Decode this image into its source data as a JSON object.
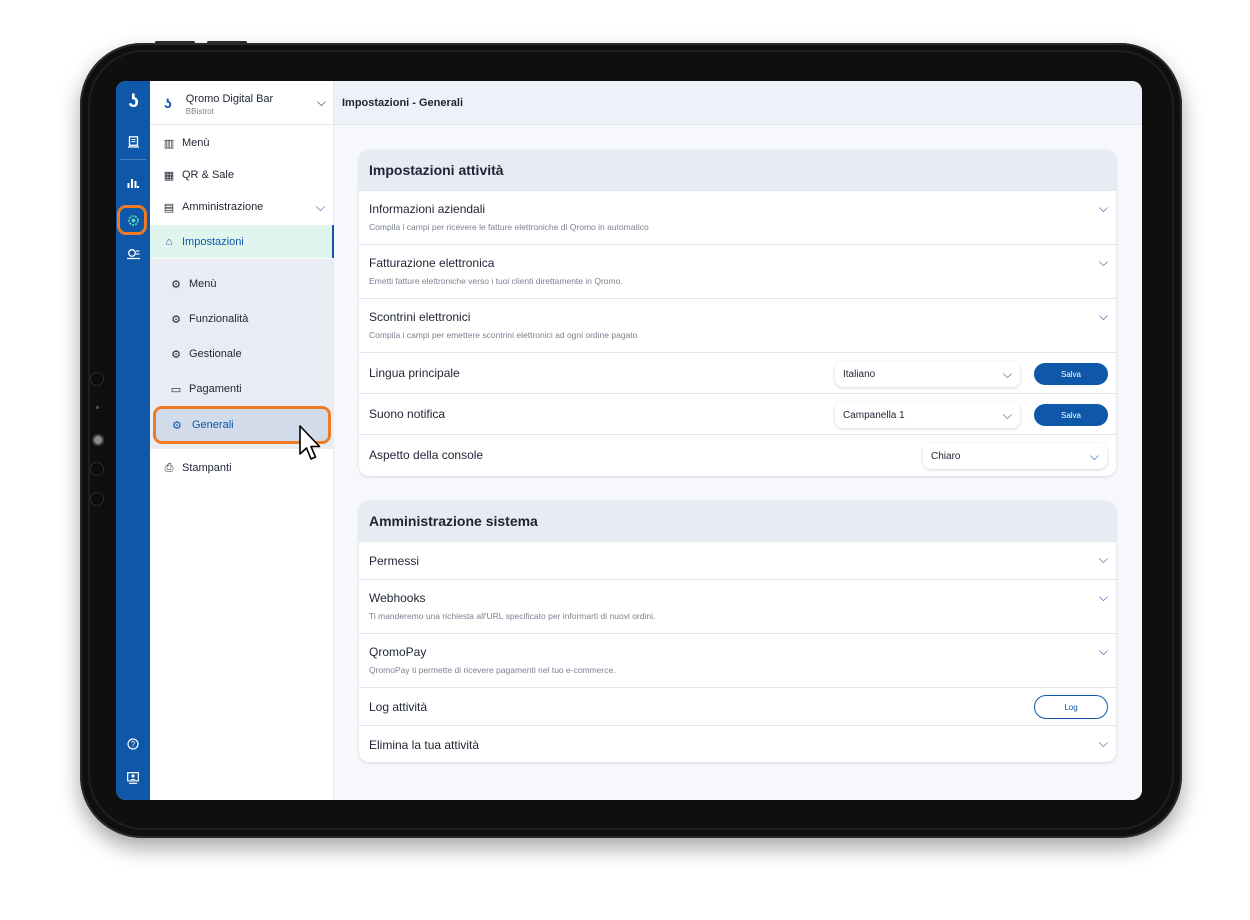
{
  "app": {
    "logo_glyph": "ʖ",
    "business_name": "Qromo Digital Bar",
    "business_sub": "BBistrot"
  },
  "rail": {
    "icons": [
      "logo-icon",
      "orders-icon",
      "stats-icon",
      "settings-icon",
      "plugins-icon",
      "help-icon",
      "console-icon"
    ]
  },
  "sidebar": {
    "items": [
      {
        "label": "Menù",
        "icon": "menu-book-icon"
      },
      {
        "label": "QR & Sale",
        "icon": "qr-icon"
      },
      {
        "label": "Amministrazione",
        "icon": "admin-icon"
      },
      {
        "label": "Impostazioni",
        "icon": "settings-store-icon"
      }
    ],
    "sub_items": [
      {
        "label": "Menù",
        "icon": "menu-gear-icon"
      },
      {
        "label": "Funzionalità",
        "icon": "features-icon"
      },
      {
        "label": "Gestionale",
        "icon": "management-icon"
      },
      {
        "label": "Pagamenti",
        "icon": "payments-icon"
      },
      {
        "label": "Generali",
        "icon": "general-gear-icon"
      }
    ],
    "bottom_item": {
      "label": "Stampanti",
      "icon": "printer-icon"
    }
  },
  "topbar": {
    "title": "Impostazioni - Generali"
  },
  "attivita": {
    "heading": "Impostazioni attività",
    "rows": [
      {
        "title": "Informazioni aziendali",
        "desc": "Compila i campi per ricevere le fatture elettroniche di Qromo in automatico"
      },
      {
        "title": "Fatturazione elettronica",
        "desc": "Emetti fatture elettroniche verso i tuoi clienti direttamente in Qromo."
      },
      {
        "title": "Scontrini elettronici",
        "desc": "Compila i campi per emettere scontrini elettronici ad ogni ordine pagato"
      }
    ],
    "lingua": {
      "title": "Lingua principale",
      "value": "Italiano",
      "save": "Salva"
    },
    "suono": {
      "title": "Suono notifica",
      "value": "Campanella 1",
      "save": "Salva"
    },
    "aspetto": {
      "title": "Aspetto della console",
      "value": "Chiaro"
    }
  },
  "sistema": {
    "heading": "Amministrazione sistema",
    "permessi": {
      "title": "Permessi"
    },
    "webhooks": {
      "title": "Webhooks",
      "desc": "Ti manderemo una richiesta all'URL specificato per informarti di nuovi ordini."
    },
    "qromopay": {
      "title": "QromoPay",
      "desc": "QromoPay ti permette di ricevere pagamenti nel tuo e-commerce."
    },
    "log": {
      "title": "Log attività",
      "button": "Log"
    },
    "elimina": {
      "title": "Elimina la tua attività"
    }
  },
  "colors": {
    "brand": "#0f57a8",
    "highlight": "#ee7b23",
    "active_bg": "#dff5ee"
  }
}
